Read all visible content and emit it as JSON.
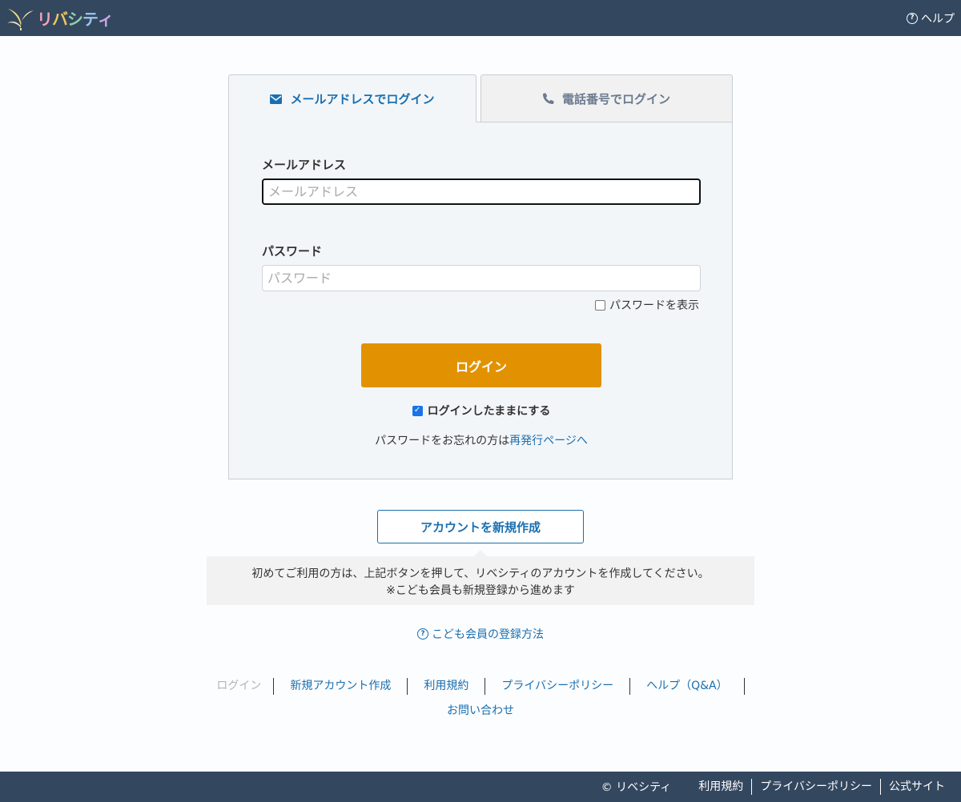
{
  "header": {
    "logo_chars": [
      "リ",
      "バ",
      "シ",
      "テ",
      "ィ"
    ],
    "logo_colors": [
      "#f5a3b8",
      "#f0c75a",
      "#8fd0a8",
      "#9cc6ec",
      "#c8a6e6"
    ],
    "help_label": "ヘルプ"
  },
  "tabs": {
    "email_label": "メールアドレスでログイン",
    "phone_label": "電話番号でログイン",
    "active": "email"
  },
  "form": {
    "email_label": "メールアドレス",
    "email_placeholder": "メールアドレス",
    "email_value": "",
    "password_label": "パスワード",
    "password_placeholder": "パスワード",
    "password_value": "",
    "show_password_label": "パスワードを表示",
    "show_password_checked": false,
    "login_button": "ログイン",
    "keep_login_label": "ログインしたままにする",
    "keep_login_checked": true,
    "forgot_text": "パスワードをお忘れの方は",
    "forgot_link": "再発行ページへ"
  },
  "signup": {
    "button": "アカウントを新規作成",
    "info_line1": "初めてご利用の方は、上記ボタンを押して、リベシティのアカウントを作成してください。",
    "info_line2": "※こども会員も新規登録から進めます",
    "child_help_link": "こども会員の登録方法"
  },
  "footer_nav": {
    "items": [
      "ログイン",
      "新規アカウント作成",
      "利用規約",
      "プライバシーポリシー",
      "ヘルプ（Q&A）"
    ],
    "contact": "お問い合わせ"
  },
  "bottom_bar": {
    "copyright": "© リベシティ",
    "links": [
      "利用規約",
      "プライバシーポリシー",
      "公式サイト"
    ]
  },
  "colors": {
    "header_bg": "#33475f",
    "accent_blue": "#1a6fb0",
    "login_button_bg": "#e29200"
  }
}
